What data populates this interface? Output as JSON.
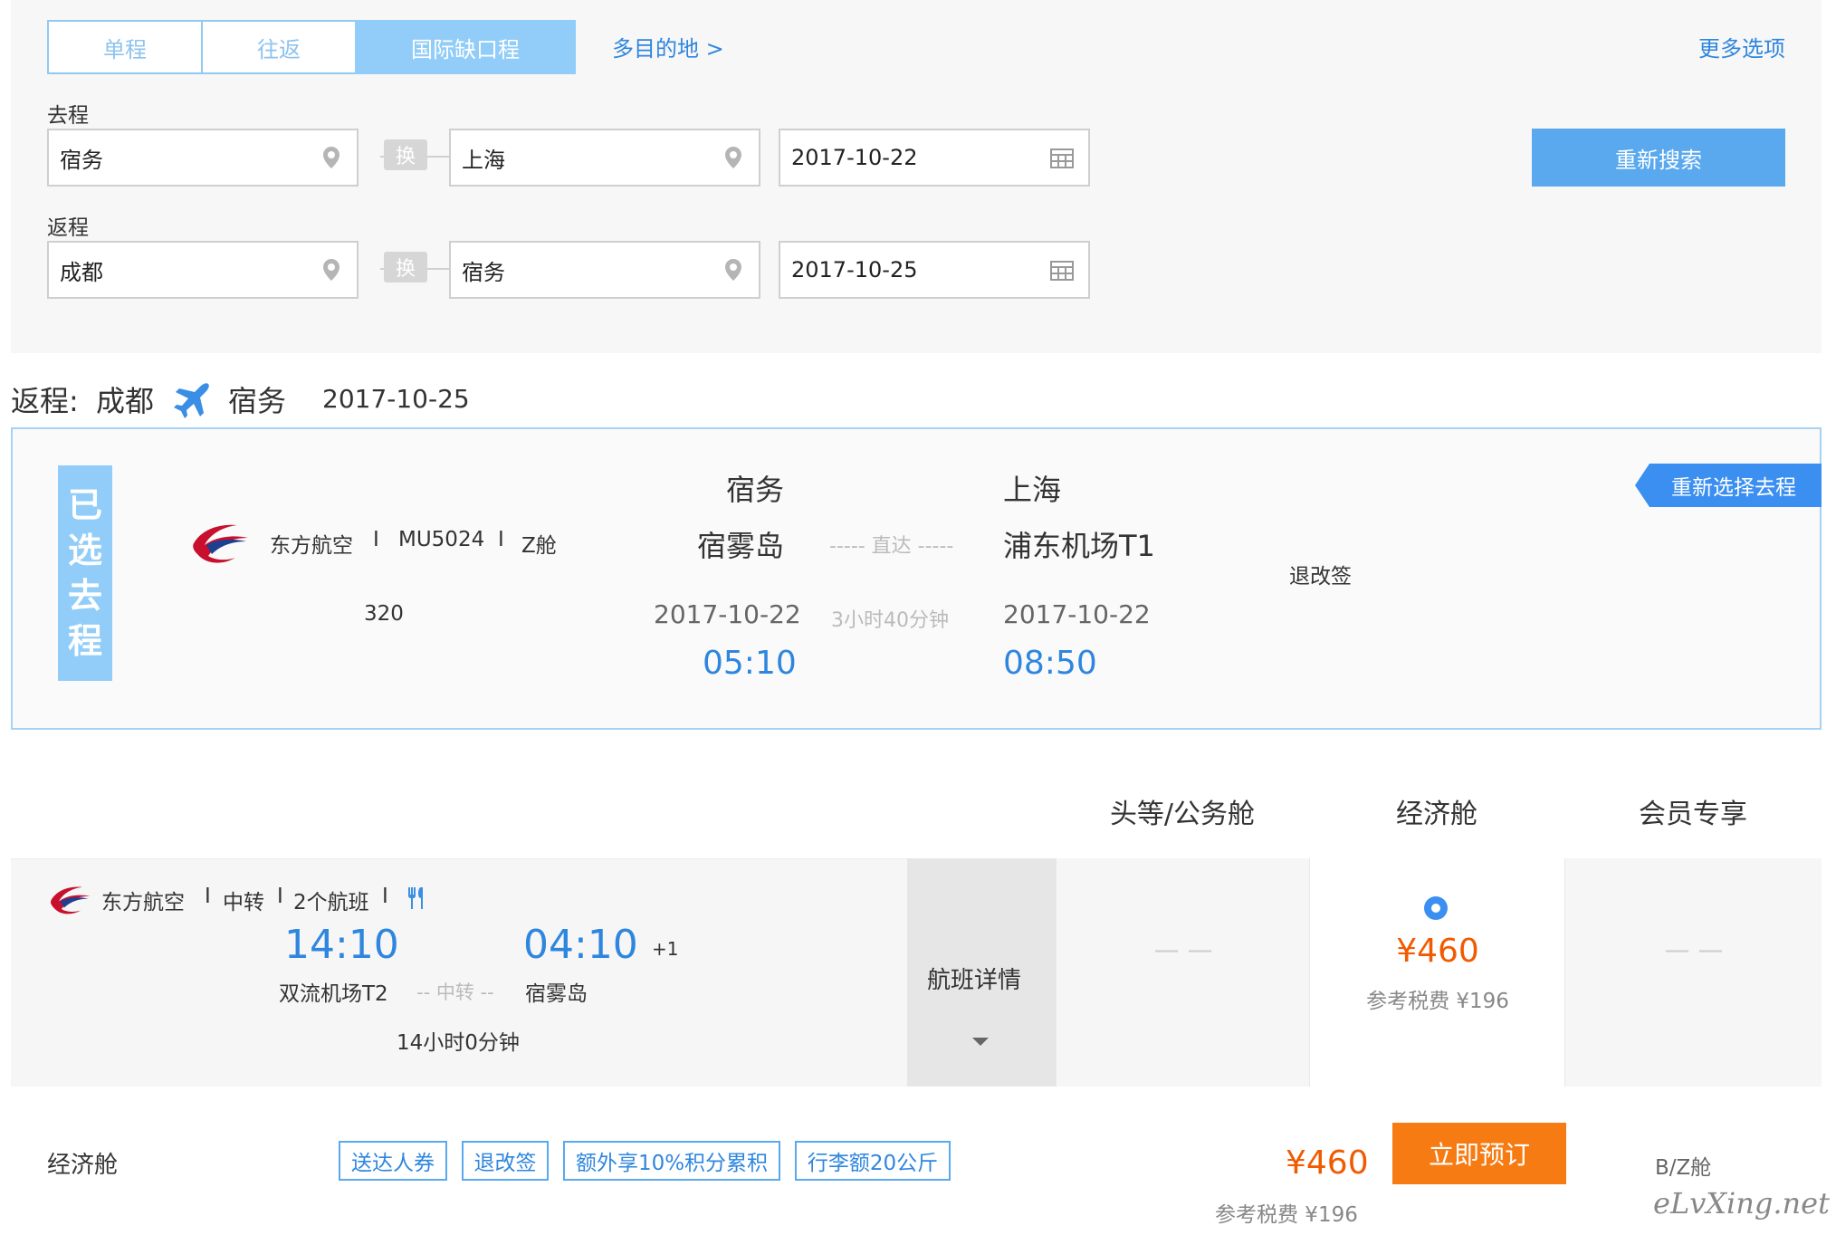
{
  "tabs": [
    {
      "label": "单程",
      "active": false
    },
    {
      "label": "往返",
      "active": false
    },
    {
      "label": "国际缺口程",
      "active": true
    }
  ],
  "multi_destination_link": "多目的地 >",
  "more_options_link": "更多选项",
  "outbound": {
    "label": "去程",
    "from": "宿务",
    "swap_label": "换",
    "to": "上海",
    "date": "2017-10-22"
  },
  "return": {
    "label": "返程",
    "from": "成都",
    "swap_label": "换",
    "to": "宿务",
    "date": "2017-10-25"
  },
  "search_button": "重新搜索",
  "return_header": {
    "prefix": "返程:",
    "from": "成都",
    "to": "宿务",
    "date": "2017-10-25"
  },
  "selected_outbound": {
    "tag_chars": [
      "已",
      "选",
      "去",
      "程"
    ],
    "airline": "东方航空",
    "sep": "I",
    "flight_no": "MU5024",
    "cabin": "Z舱",
    "aircraft": "320",
    "dep_city": "宿务",
    "dep_airport": "宿雾岛",
    "dep_date": "2017-10-22",
    "dep_time": "05:10",
    "direct_label": "----- 直达 -----",
    "duration": "3小时40分钟",
    "arr_city": "上海",
    "arr_airport": "浦东机场T1",
    "arr_date": "2017-10-22",
    "arr_time": "08:50",
    "refund_label": "退改签",
    "reselect_button": "重新选择去程"
  },
  "cabin_headers": [
    "头等/公务舱",
    "经济舱",
    "会员专享"
  ],
  "return_flight": {
    "airline": "东方航空",
    "sep": "I",
    "transfer": "中转",
    "flights_count": "2个航班",
    "dep_time": "14:10",
    "dep_airport": "双流机场T2",
    "transfer_label": "-- 中转 --",
    "arr_time": "04:10",
    "next_day": "+1",
    "arr_airport": "宿雾岛",
    "duration": "14小时0分钟",
    "detail_label": "航班详情",
    "first_class_price": "— —",
    "economy_price": "¥460",
    "economy_tax": "参考税费 ¥196",
    "member_price": "— —"
  },
  "fare_option": {
    "cabin": "经济舱",
    "badges": [
      "送达人券",
      "退改签",
      "额外享10%积分累积",
      "行李额20公斤"
    ],
    "price": "¥460",
    "tax": "参考税费 ¥196",
    "book_button": "立即预订",
    "fare_class": "B/Z舱"
  },
  "watermark": "eLvXing.net",
  "colors": {
    "accent_blue": "#2e86de",
    "tab_blue": "#91cdf8",
    "button_blue": "#5aa9ee",
    "orange": "#f77b13",
    "price_orange": "#f05a00"
  }
}
